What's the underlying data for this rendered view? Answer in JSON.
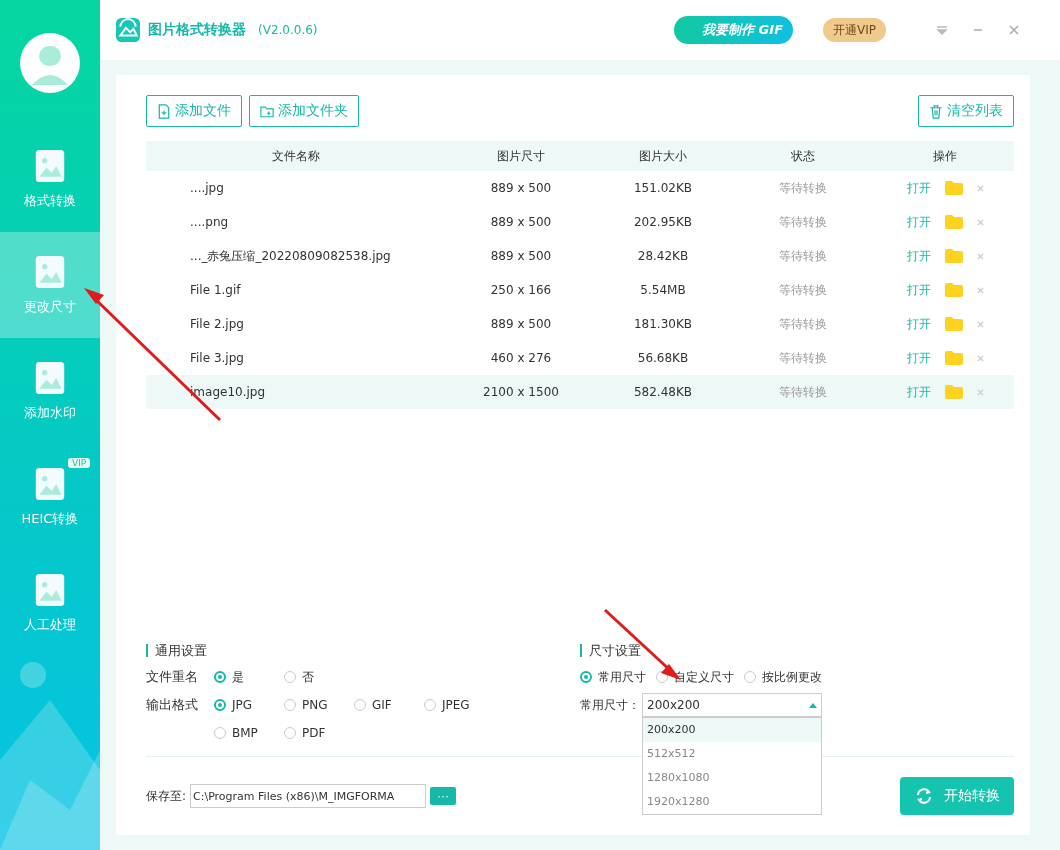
{
  "app": {
    "title": "图片格式转换器",
    "version": "(V2.0.0.6)",
    "gif_button": "我要制作 GIF",
    "vip_button": "开通VIP"
  },
  "sidebar": {
    "items": [
      {
        "label": "格式转换",
        "selected": false
      },
      {
        "label": "更改尺寸",
        "selected": true
      },
      {
        "label": "添加水印",
        "selected": false
      },
      {
        "label": "HEIC转换",
        "selected": false,
        "badge": "VIP"
      },
      {
        "label": "人工处理",
        "selected": false
      }
    ]
  },
  "toolbar": {
    "add_file": "添加文件",
    "add_folder": "添加文件夹",
    "clear": "清空列表"
  },
  "table": {
    "columns": [
      "文件名称",
      "图片尺寸",
      "图片大小",
      "状态",
      "操作"
    ],
    "rows": [
      {
        "name": "....jpg",
        "dimensions": "889 x 500",
        "size": "151.02KB",
        "status": "等待转换",
        "action": "打开",
        "selected": false
      },
      {
        "name": "....png",
        "dimensions": "889 x 500",
        "size": "202.95KB",
        "status": "等待转换",
        "action": "打开",
        "selected": false
      },
      {
        "name": "..._赤兔压缩_20220809082538.jpg",
        "dimensions": "889 x 500",
        "size": "28.42KB",
        "status": "等待转换",
        "action": "打开",
        "selected": false
      },
      {
        "name": "File 1.gif",
        "dimensions": "250 x 166",
        "size": "5.54MB",
        "status": "等待转换",
        "action": "打开",
        "selected": false
      },
      {
        "name": "File 2.jpg",
        "dimensions": "889 x 500",
        "size": "181.30KB",
        "status": "等待转换",
        "action": "打开",
        "selected": false
      },
      {
        "name": "File 3.jpg",
        "dimensions": "460 x 276",
        "size": "56.68KB",
        "status": "等待转换",
        "action": "打开",
        "selected": false
      },
      {
        "name": "image10.jpg",
        "dimensions": "2100 x 1500",
        "size": "582.48KB",
        "status": "等待转换",
        "action": "打开",
        "selected": true
      }
    ]
  },
  "general_settings": {
    "title": "通用设置",
    "rename": {
      "label": "文件重名",
      "options": [
        {
          "label": "是",
          "selected": true
        },
        {
          "label": "否",
          "selected": false
        }
      ]
    },
    "format": {
      "label": "输出格式",
      "options": [
        {
          "label": "JPG",
          "selected": true
        },
        {
          "label": "PNG",
          "selected": false
        },
        {
          "label": "GIF",
          "selected": false
        },
        {
          "label": "JPEG",
          "selected": false
        },
        {
          "label": "BMP",
          "selected": false
        },
        {
          "label": "PDF",
          "selected": false
        }
      ]
    }
  },
  "size_settings": {
    "title": "尺寸设置",
    "modes": [
      {
        "label": "常用尺寸",
        "selected": true
      },
      {
        "label": "自定义尺寸",
        "selected": false
      },
      {
        "label": "按比例更改",
        "selected": false
      }
    ],
    "common_size": {
      "label": "常用尺寸：",
      "value": "200x200",
      "expanded": true,
      "options": [
        {
          "label": "200x200",
          "selected": true
        },
        {
          "label": "512x512",
          "selected": false
        },
        {
          "label": "1280x1080",
          "selected": false
        },
        {
          "label": "1920x1280",
          "selected": false
        }
      ]
    }
  },
  "save": {
    "label": "保存至:",
    "path": "C:\\Program Files (x86)\\M_IMGFORMA",
    "browse_button": "···"
  },
  "start_button": "开始转换"
}
